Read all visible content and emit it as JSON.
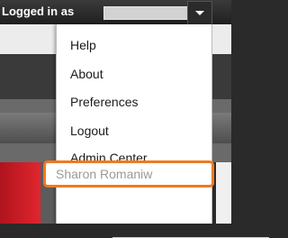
{
  "header": {
    "logged_in_label": "Logged in as"
  },
  "menu": {
    "items": [
      {
        "label": "Help"
      },
      {
        "label": "About"
      },
      {
        "label": "Preferences"
      },
      {
        "label": "Logout"
      },
      {
        "label": "Admin Center"
      }
    ],
    "current_user": "Sharon Romaniw"
  },
  "colors": {
    "highlight": "#f07a1f",
    "topbar": "#2b2b2b"
  },
  "icons": {
    "menu_toggle": "caret-down-icon"
  }
}
